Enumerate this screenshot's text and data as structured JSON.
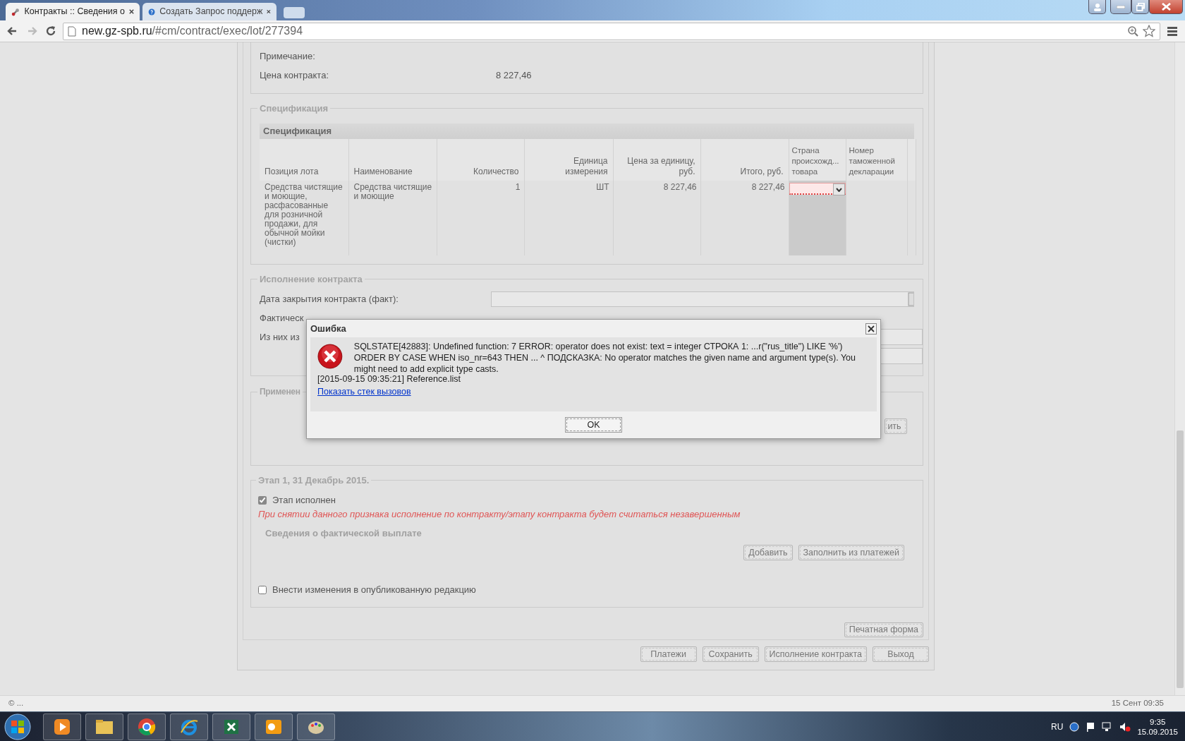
{
  "browser": {
    "tabs": [
      {
        "title": "Контракты :: Сведения о",
        "selected": true
      },
      {
        "title": "Создать Запрос поддерж",
        "selected": false
      }
    ],
    "url_host": "new.gz-spb.ru",
    "url_path": "/#cm/contract/exec/lot/277394"
  },
  "contract_info": [
    {
      "label": "Примечание:"
    },
    {
      "label": "Цена контракта:",
      "value": "8 227,46"
    }
  ],
  "specification": {
    "legend": "Спецификация",
    "grid_title": "Спецификация",
    "columns": [
      "Позиция лота",
      "Наименование",
      "Количество",
      "Единица измерения",
      "Цена за единицу, руб.",
      "Итого, руб.",
      "Страна происхожд... товара",
      "Номер таможенной декларации"
    ],
    "rows": [
      {
        "cells": [
          "Средства чистящие и моющие, расфасованные для розничной продажи, для обычной мойки (чистки)",
          "Средства чистящие и моющие",
          "1",
          "ШТ",
          "8 227,46",
          "8 227,46"
        ],
        "country_invalid": true
      }
    ]
  },
  "execution": {
    "legend": "Исполнение контракта",
    "fields": [
      {
        "label": "Дата закрытия контракта (факт):",
        "kind": "date"
      },
      {
        "label": "Фактическ",
        "kind": "covered"
      },
      {
        "label": "Из них из",
        "kind": "partial"
      },
      {
        "kind": "partial"
      }
    ]
  },
  "application": {
    "legend": "Применен",
    "button": "ить"
  },
  "stage": {
    "legend": "Этап 1, 31 Декабрь 2015.",
    "done": {
      "label": "Этап исполнен",
      "checked": true
    },
    "warning": "При снятии данного признака исполнение по контракту/этапу контракта будет считаться незавершенным",
    "payments_title": "Сведения о фактической выплате",
    "buttons": [
      "Добавить",
      "Заполнить из платежей"
    ],
    "publish": {
      "label": "Внести изменения в опубликованную редакцию",
      "checked": false
    }
  },
  "print_button": "Печатная форма",
  "footer_buttons": [
    "Платежи",
    "Сохранить",
    "Исполнение контракта",
    "Выход"
  ],
  "dialog": {
    "title": "Ошибка",
    "message": "SQLSTATE[42883]: Undefined function: 7 ERROR: operator does not exist: text = integer СТРОКА 1: ...r(\"rus_title\") LIKE '%') ORDER BY CASE WHEN iso_nr=643 THEN ... ^ ПОДСКАЗКА: No operator matches the given name and argument type(s). You might need to add explicit type casts.",
    "timestamp_line": "[2015-09-15 09:35:21] Reference.list",
    "link": "Показать стек вызовов",
    "button": "OK"
  },
  "status_bar": {
    "left": "© ...",
    "right": "15 Сент 09:35"
  },
  "taskbar": {
    "language": "RU",
    "time": "9:35",
    "date": "15.09.2015"
  }
}
